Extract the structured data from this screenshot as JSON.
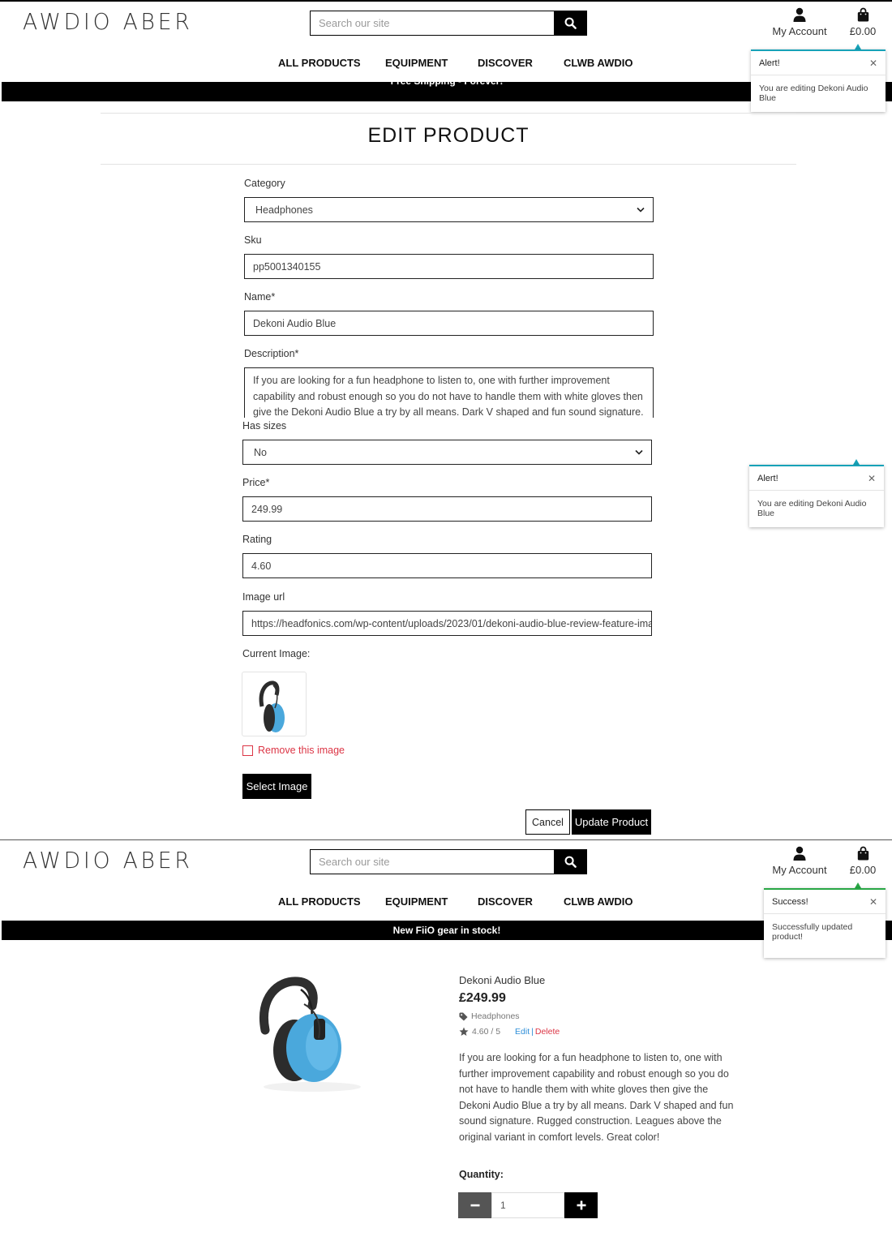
{
  "header": {
    "logo": "AWDIO ABER",
    "search_placeholder": "Search our site",
    "account_label": "My Account",
    "bag_total": "£0.00"
  },
  "nav": [
    "ALL PRODUCTS",
    "EQUIPMENT",
    "DISCOVER",
    "CLWB AWDIO"
  ],
  "banner_top": "Free Shipping - Forever!",
  "banner_bottom": "New FiiO gear in stock!",
  "toast_alert": {
    "title": "Alert!",
    "message": "You are editing Dekoni Audio Blue",
    "accent": "#17a2b8"
  },
  "toast_success": {
    "title": "Success!",
    "message": "Successfully updated product!",
    "accent": "#28a745"
  },
  "form": {
    "title": "EDIT PRODUCT",
    "category_label": "Category",
    "category_value": "Headphones",
    "sku_label": "Sku",
    "sku_value": "pp5001340155",
    "name_label": "Name*",
    "name_value": "Dekoni Audio Blue",
    "description_label": "Description*",
    "description_value": "If you are looking for a fun headphone to listen to, one with further improvement capability and robust enough so you do not have to handle them with white gloves then give the Dekoni Audio Blue a try by all means. Dark V shaped and fun sound signature. Rugged construction. Leagues",
    "has_sizes_label": "Has sizes",
    "has_sizes_value": "No",
    "price_label": "Price*",
    "price_value": "249.99",
    "rating_label": "Rating",
    "rating_value": "4.60",
    "image_url_label": "Image url",
    "image_url_value": "https://headfonics.com/wp-content/uploads/2023/01/dekoni-audio-blue-review-feature-image",
    "current_image_label": "Current Image:",
    "remove_image_label": "Remove this image",
    "select_image_label": "Select Image",
    "cancel_label": "Cancel",
    "update_label": "Update Product"
  },
  "product": {
    "name": "Dekoni Audio Blue",
    "price": "£249.99",
    "category": "Headphones",
    "rating": "4.60 / 5",
    "edit_label": "Edit",
    "separator": "|",
    "delete_label": "Delete",
    "description": "If you are looking for a fun headphone to listen to, one with further improvement capability and robust enough so you do not have to handle them with white gloves then give the Dekoni Audio Blue a try by all means. Dark V shaped and fun sound signature. Rugged construction. Leagues above the original variant in comfort levels. Great color!",
    "quantity_label": "Quantity:",
    "quantity_value": "1"
  },
  "icons": {
    "search": "search-icon",
    "account": "user-icon",
    "bag": "shopping-bag-icon",
    "tag": "tag-icon",
    "star": "star-icon",
    "minus": "minus-icon",
    "plus": "plus-icon"
  }
}
